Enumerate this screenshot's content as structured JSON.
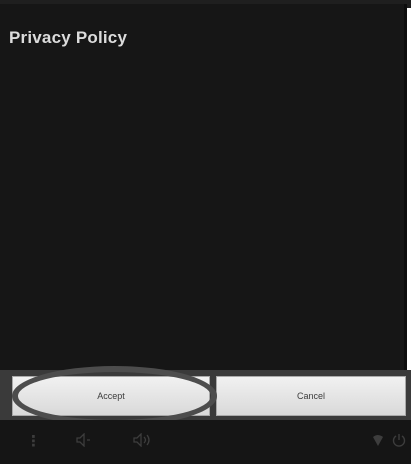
{
  "dialog": {
    "title": "Privacy Policy",
    "accept_label": "Accept",
    "cancel_label": "Cancel"
  },
  "nav_bar": {
    "icons": [
      "menu-icon",
      "volume-down-icon",
      "volume-up-icon",
      "wifi-icon",
      "power-icon"
    ]
  },
  "colors": {
    "panel_background": "#161616",
    "button_background": "#e6e6e6",
    "highlight_ring": "#4d4d4d"
  }
}
